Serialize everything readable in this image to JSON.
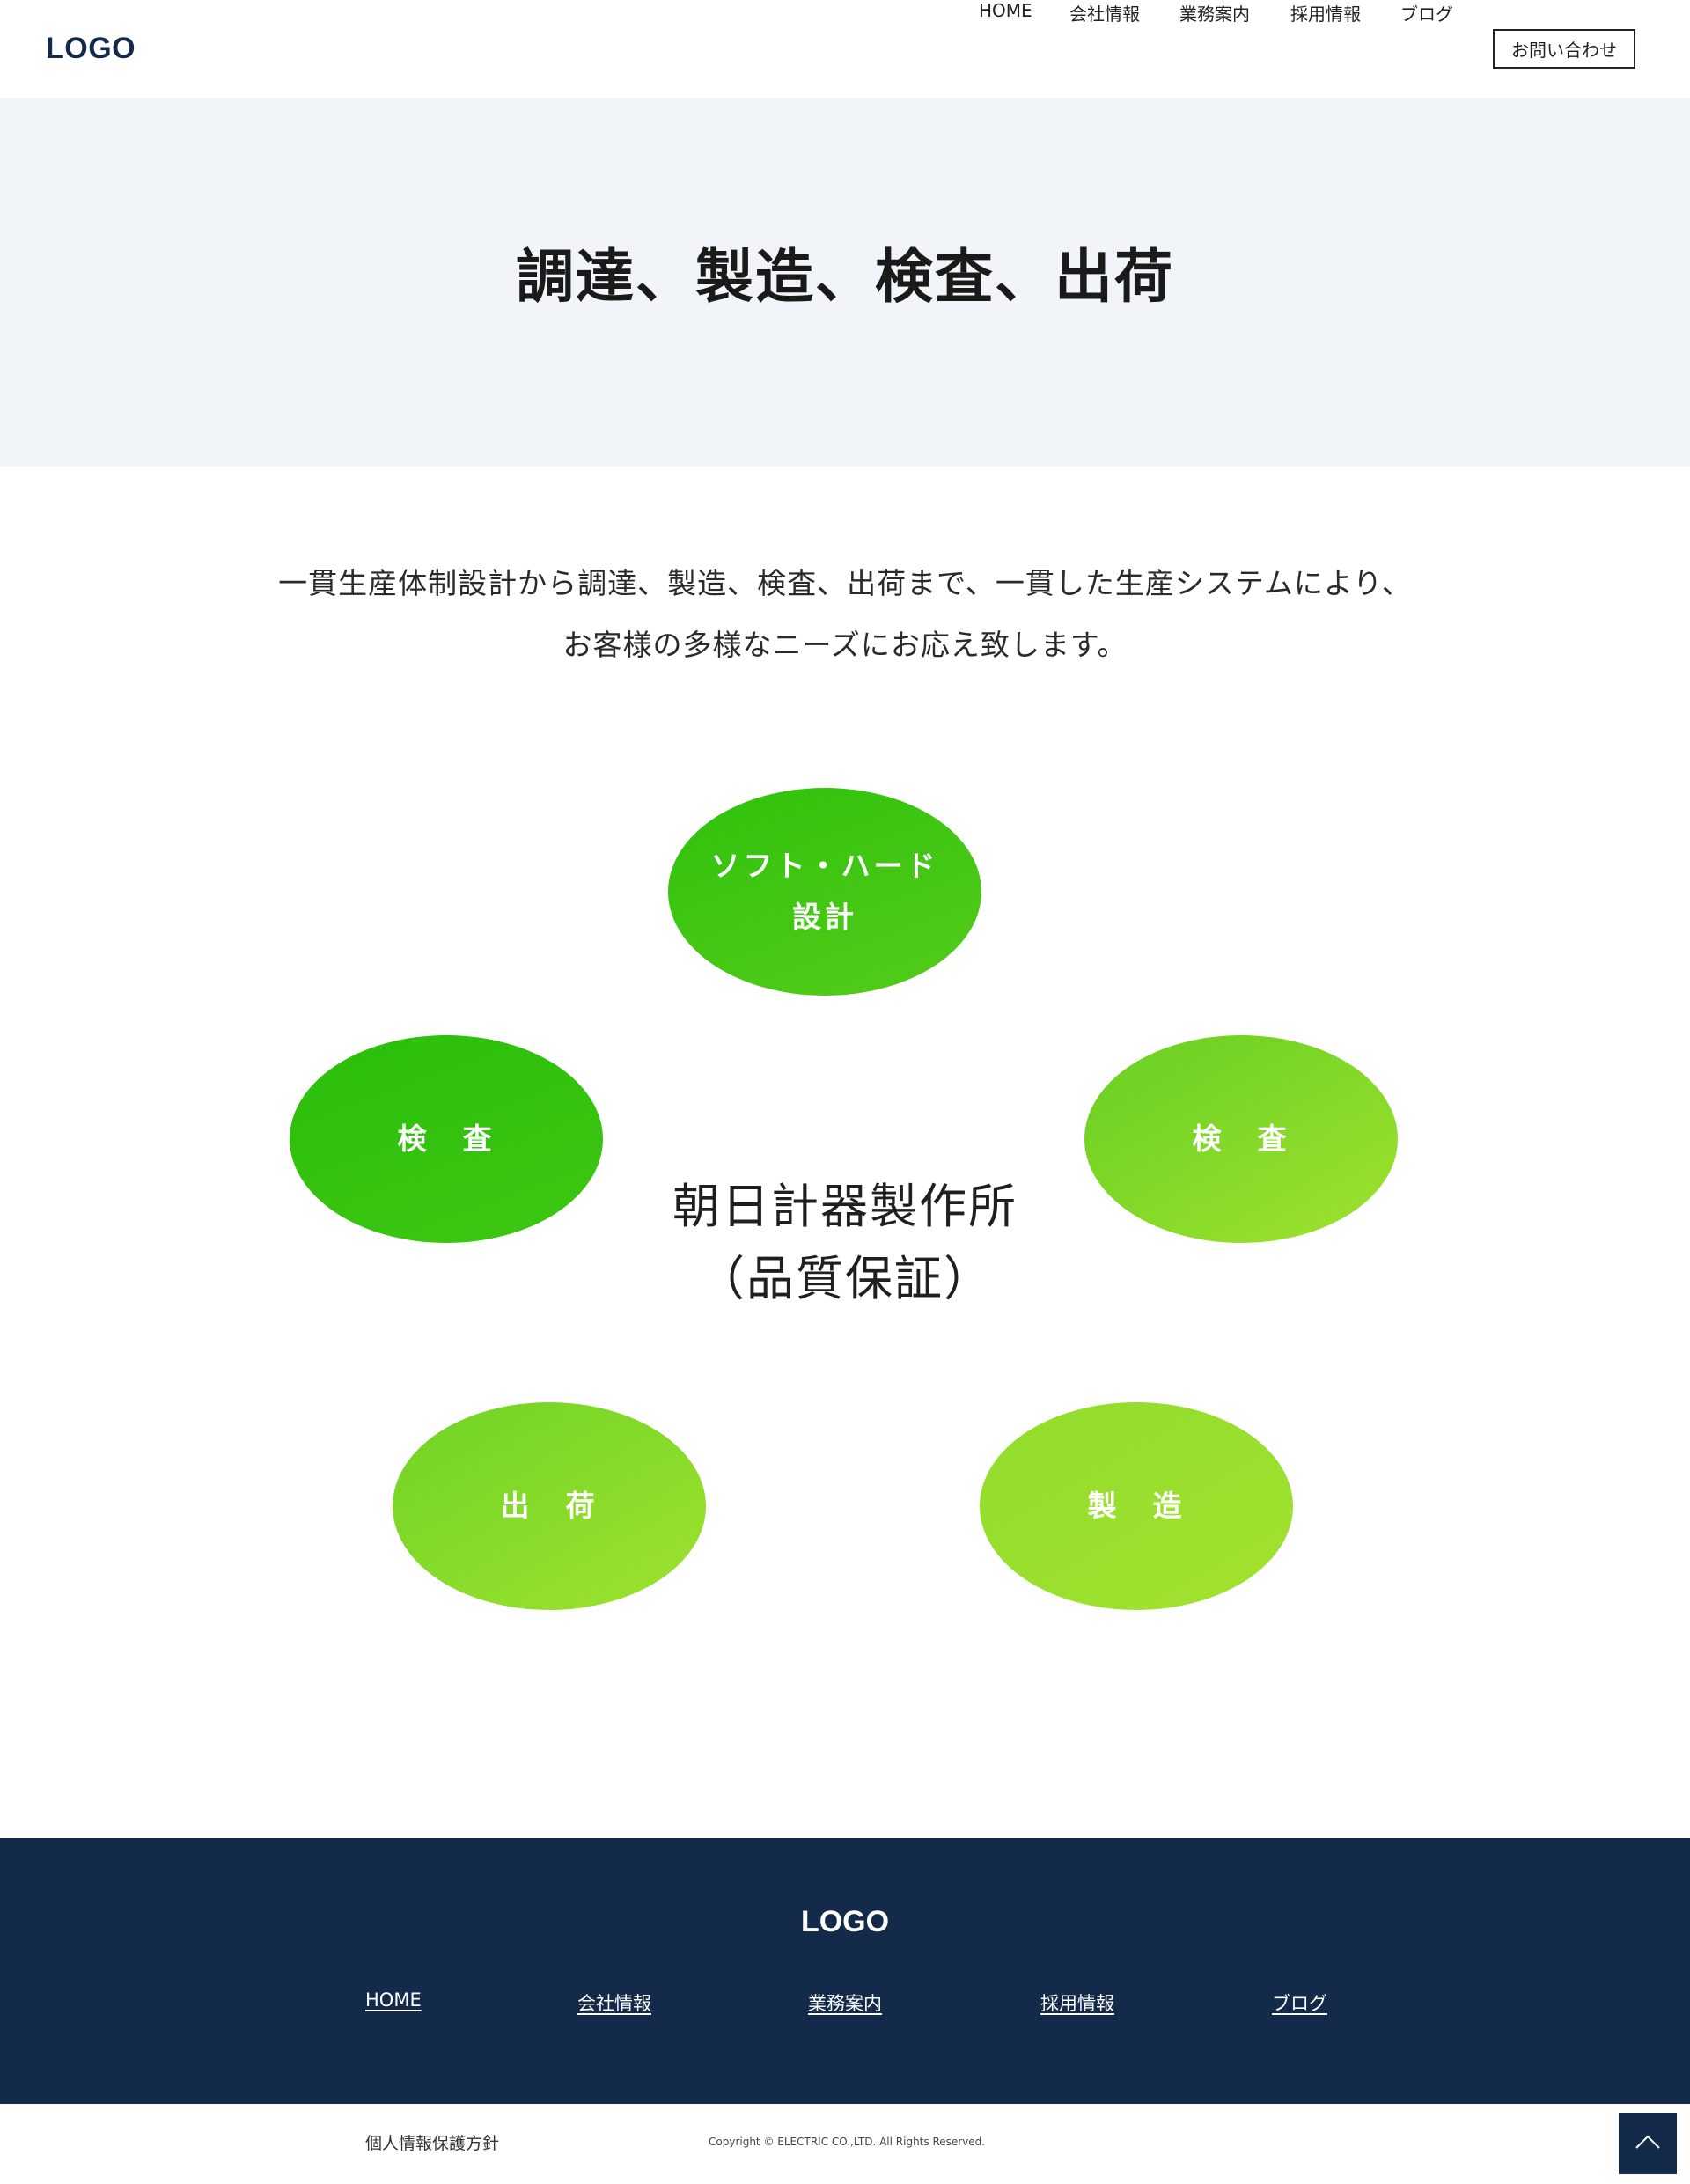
{
  "header": {
    "logo": "LOGO",
    "nav": [
      {
        "label": "HOME"
      },
      {
        "label": "会社情報"
      },
      {
        "label": "業務案内"
      },
      {
        "label": "採用情報"
      },
      {
        "label": "ブログ"
      }
    ],
    "contact_label": "お問い合わせ"
  },
  "hero": {
    "title": "調達、製造、検査、出荷"
  },
  "intro": {
    "line1": "一貫生産体制設計から調達、製造、検査、出荷まで、一貫した生産システムにより、",
    "line2": "お客様の多様なニーズにお応え致します。"
  },
  "diagram": {
    "center_line1": "朝日計器製作所",
    "center_line2": "（品質保証）",
    "nodes": [
      {
        "line1": "ソフト・ハード",
        "line2": "設計"
      },
      {
        "line1": "検　査"
      },
      {
        "line1": "検　査"
      },
      {
        "line1": "出　荷"
      },
      {
        "line1": "製　造"
      }
    ],
    "colors": {
      "green_dark": "#2ec10c",
      "green_mid": "#6fd324",
      "green_light": "#9fe22f"
    }
  },
  "footer": {
    "logo": "LOGO",
    "links": [
      {
        "label": "HOME"
      },
      {
        "label": "会社情報"
      },
      {
        "label": "業務案内"
      },
      {
        "label": "採用情報"
      },
      {
        "label": "ブログ"
      }
    ],
    "privacy": "個人情報保護方針",
    "copyright": "Copyright © ELECTRIC CO.,LTD. All Rights Reserved.",
    "background": "#142a4a"
  },
  "icons": {
    "back_to_top": "chevron-up-icon"
  }
}
